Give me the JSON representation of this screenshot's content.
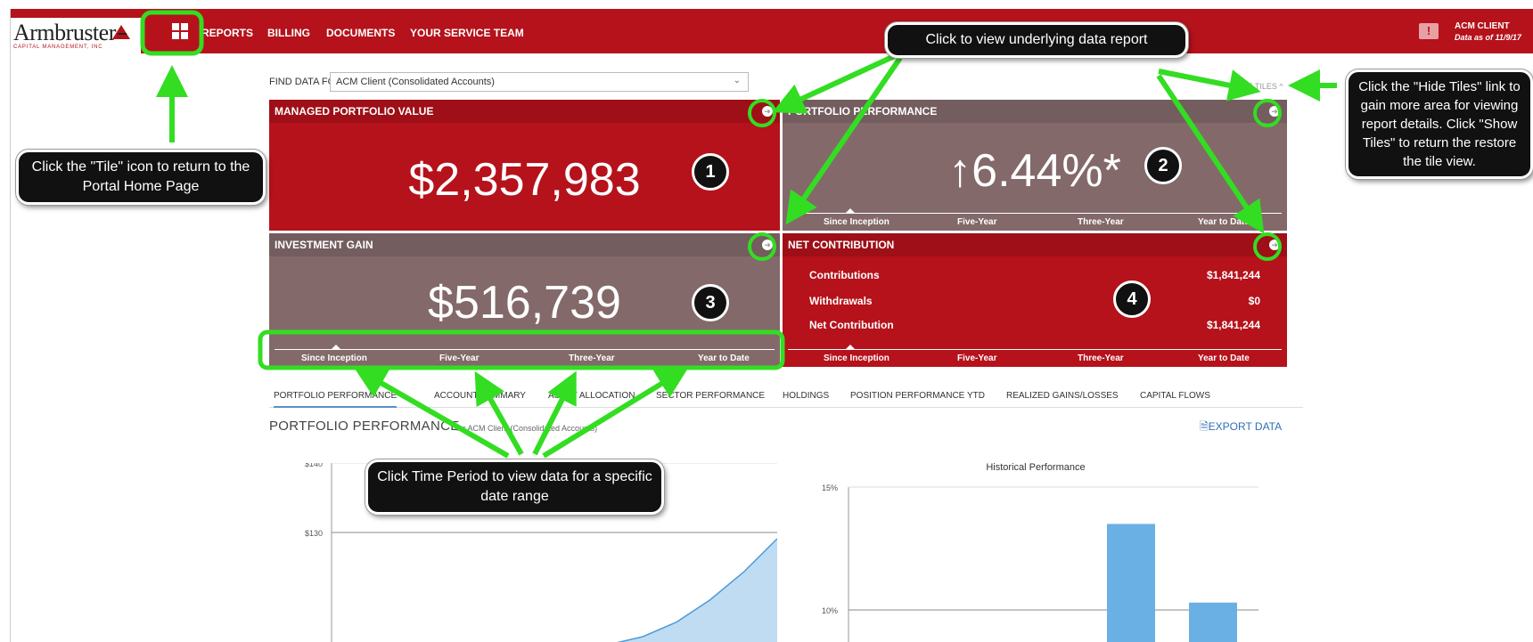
{
  "header": {
    "logo_name": "Armbruster",
    "logo_sub": "CAPITAL MANAGEMENT, INC",
    "nav": [
      "REPORTS",
      "BILLING",
      "DOCUMENTS",
      "YOUR SERVICE TEAM"
    ],
    "user_icon": "!",
    "user_name": "ACM CLIENT",
    "user_date": "Data as of 11/9/17"
  },
  "filter": {
    "label": "FIND DATA FOR",
    "value": "ACM Client (Consolidated Accounts)",
    "hide_tiles": "HIDE TILES ^"
  },
  "tiles": {
    "portfolio_value": {
      "title": "MANAGED PORTFOLIO VALUE",
      "value": "$2,357,983"
    },
    "performance": {
      "title": "PORTFOLIO PERFORMANCE",
      "value": "↑6.44%*"
    },
    "investment_gain": {
      "title": "INVESTMENT GAIN",
      "value": "$516,739"
    },
    "net_contribution": {
      "title": "NET CONTRIBUTION",
      "rows": [
        {
          "label": "Contributions",
          "value": "$1,841,244"
        },
        {
          "label": "Withdrawals",
          "value": "$0"
        },
        {
          "label": "Net Contribution",
          "value": "$1,841,244"
        }
      ]
    },
    "periods": [
      "Since Inception",
      "Five-Year",
      "Three-Year",
      "Year to Date"
    ]
  },
  "tabs": [
    "PORTFOLIO PERFORMANCE",
    "ACCOUNT SUMMARY",
    "ASSET ALLOCATION",
    "SECTOR PERFORMANCE",
    "HOLDINGS",
    "POSITION PERFORMANCE YTD",
    "REALIZED GAINS/LOSSES",
    "CAPITAL FLOWS"
  ],
  "section": {
    "title": "PORTFOLIO PERFORMANCE",
    "subtitle": "for ACM Client (Consolidated Accounts)",
    "export": "EXPORT DATA"
  },
  "chart_data": [
    {
      "type": "area",
      "title": "",
      "y_ticks": [
        "$140",
        "$130"
      ],
      "series": [
        {
          "values": [
            0,
            0,
            0,
            0,
            0,
            0,
            0,
            0,
            0.05,
            0.12,
            0.25,
            0.45,
            0.7,
            1.0
          ]
        }
      ]
    },
    {
      "type": "bar",
      "title": "Historical Performance",
      "y_ticks": [
        "15%",
        "10%"
      ],
      "ylim": [
        5,
        15
      ],
      "values": [
        13.5,
        10.3
      ]
    }
  ],
  "callouts": {
    "tile_icon": "Click the \"Tile\" icon to return to the Portal Home Page",
    "data_report": "Click to view underlying data report",
    "hide_tiles": "Click the \"Hide Tiles\" link to gain more  area for viewing report details. Click \"Show Tiles\"  to return the restore  the tile view.",
    "time_period": "Click Time Period to view data for a specific date range",
    "badges": [
      "1",
      "2",
      "3",
      "4"
    ]
  },
  "colors": {
    "brand_red": "#b5121b",
    "tile_gray": "#83696a",
    "highlight_green": "#33dd22",
    "bar_blue": "#6ab0e4"
  }
}
